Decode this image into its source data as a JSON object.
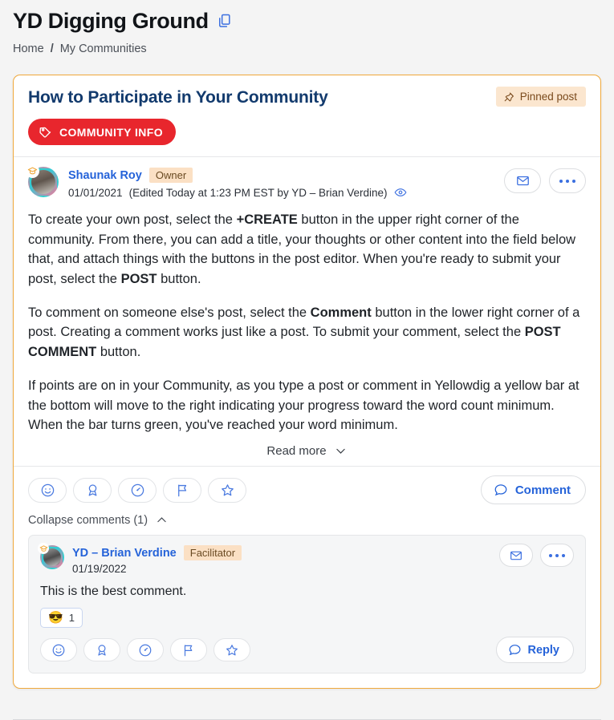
{
  "header": {
    "title": "YD Digging Ground",
    "copy_icon": "copy-documents-icon",
    "breadcrumb": {
      "home": "Home",
      "separator": "/",
      "current": "My Communities"
    }
  },
  "post": {
    "title": "How to Participate in Your Community",
    "pinned_badge": {
      "icon": "pushpin-icon",
      "label": "Pinned post"
    },
    "tag": {
      "icon": "tag-icon",
      "label": "COMMUNITY INFO",
      "color": "#e8262d"
    },
    "author": {
      "name": "Shaunak Roy",
      "role": "Owner",
      "avatar_badge": "graduation-cap-icon",
      "date": "01/01/2021",
      "edited_note": "(Edited Today at 1:23 PM EST by YD – Brian Verdine)",
      "visibility_icon": "eye-icon"
    },
    "head_actions": {
      "message_icon": "envelope-icon",
      "more_icon": "ellipsis-icon"
    },
    "paragraphs": [
      {
        "segments": [
          {
            "text": "To create your own post, select the ",
            "bold": false
          },
          {
            "text": "+CREATE",
            "bold": true
          },
          {
            "text": " button in the upper right corner of the community. From there, you can add a title, your thoughts or other content into the field below that, and attach things with the buttons in the post editor. When you're ready to submit your post, select the ",
            "bold": false
          },
          {
            "text": "POST",
            "bold": true
          },
          {
            "text": " button.",
            "bold": false
          }
        ]
      },
      {
        "segments": [
          {
            "text": "To comment on someone else's post, select the ",
            "bold": false
          },
          {
            "text": "Comment",
            "bold": true
          },
          {
            "text": " button in the lower right corner of a post. Creating a comment works just like a post. To submit your comment, select the ",
            "bold": false
          },
          {
            "text": "POST COMMENT",
            "bold": true
          },
          {
            "text": " button.",
            "bold": false
          }
        ]
      },
      {
        "segments": [
          {
            "text": "If points are on in your Community, as you type a post or comment in Yellowdig a yellow bar at the bottom will move to the right indicating your progress toward the word count minimum. When the bar turns green, you've reached your word minimum.",
            "bold": false
          }
        ]
      }
    ],
    "read_more": {
      "label": "Read more",
      "icon": "chevron-down-icon"
    },
    "reactions": [
      {
        "icon": "smiley-face-icon"
      },
      {
        "icon": "award-ribbon-icon"
      },
      {
        "icon": "gauge-icon"
      },
      {
        "icon": "flag-icon"
      },
      {
        "icon": "star-icon"
      }
    ],
    "comment_button": {
      "icon": "speech-bubble-icon",
      "label": "Comment"
    },
    "collapse": {
      "label": "Collapse comments (1)",
      "icon": "chevron-up-icon"
    }
  },
  "comment": {
    "author": {
      "name": "YD – Brian Verdine",
      "role": "Facilitator",
      "avatar_badge": "graduation-cap-icon",
      "date": "01/19/2022"
    },
    "actions": {
      "message_icon": "envelope-icon",
      "more_icon": "ellipsis-icon"
    },
    "text": "This is the best comment.",
    "emoji_reaction": {
      "glyph": "😎",
      "count": "1"
    },
    "reactions": [
      {
        "icon": "smiley-face-icon"
      },
      {
        "icon": "award-ribbon-icon"
      },
      {
        "icon": "gauge-icon"
      },
      {
        "icon": "flag-icon"
      },
      {
        "icon": "star-icon"
      }
    ],
    "reply_button": {
      "icon": "speech-bubble-icon",
      "label": "Reply"
    }
  }
}
